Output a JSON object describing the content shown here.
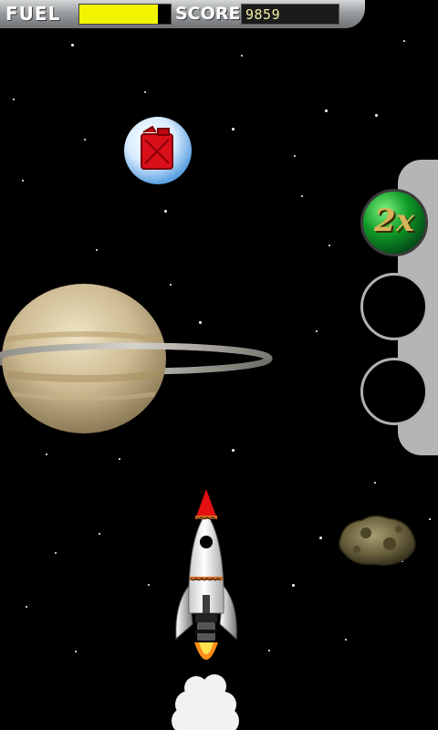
{
  "hud": {
    "fuel_label": "FUEL",
    "fuel_level": 0.86,
    "score_label": "SCORE",
    "score_value": "9859"
  },
  "powerups": {
    "slots": [
      {
        "state": "filled",
        "label": "2x",
        "icon": "score-multiplier-icon"
      },
      {
        "state": "empty"
      },
      {
        "state": "empty"
      }
    ]
  },
  "scene": {
    "pickup": {
      "icon": "fuel-can-bubble-icon"
    },
    "player": {
      "icon": "rocket-icon"
    },
    "obstacle": {
      "icon": "asteroid-icon"
    },
    "background_object": {
      "icon": "ringed-planet-icon"
    }
  },
  "colors": {
    "fuel_bar": "#f2f400",
    "space": "#000000",
    "hud": "#9a9da0",
    "multiplier": "#0f9b27"
  }
}
